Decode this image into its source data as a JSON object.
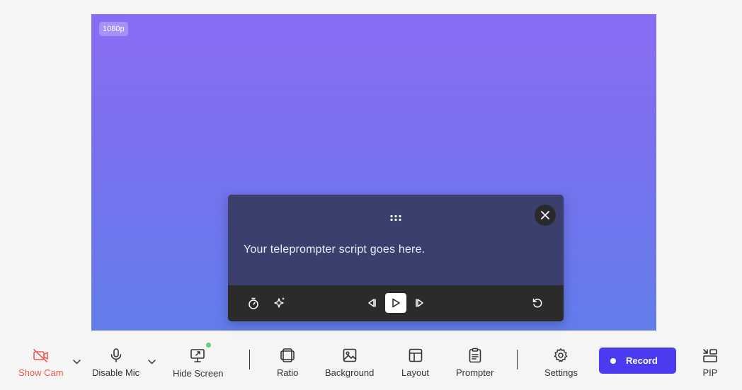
{
  "preview": {
    "resolution_badge": "1080p"
  },
  "teleprompter": {
    "script_text": "Your teleprompter script goes here.",
    "icons": {
      "drag": "drag-handle-icon",
      "close": "close-icon",
      "timer": "timer-icon",
      "ai": "sparkle-icon",
      "prev": "skip-back-icon",
      "play": "play-icon",
      "next": "skip-forward-icon",
      "reset": "reset-icon"
    }
  },
  "toolbar": {
    "show_cam": "Show Cam",
    "disable_mic": "Disable Mic",
    "hide_screen": "Hide Screen",
    "ratio": "Ratio",
    "background": "Background",
    "layout": "Layout",
    "prompter": "Prompter",
    "settings": "Settings",
    "record": "Record",
    "pip": "PIP"
  },
  "colors": {
    "cam_off": "#ea5a4c",
    "record_button": "#4a3bf0",
    "screen_live_dot": "#5ed07a"
  }
}
